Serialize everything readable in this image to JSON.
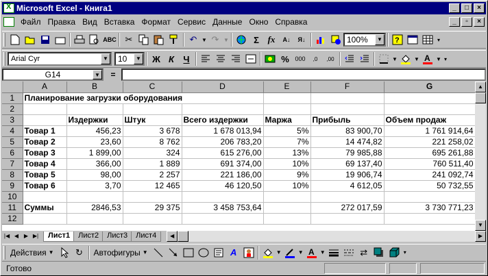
{
  "window": {
    "title": "Microsoft Excel - Книга1",
    "controls": [
      "_",
      "□",
      "×"
    ]
  },
  "menu": {
    "items": [
      "Файл",
      "Правка",
      "Вид",
      "Вставка",
      "Формат",
      "Сервис",
      "Данные",
      "Окно",
      "Справка"
    ],
    "doc_controls": [
      "_",
      "▫",
      "×"
    ]
  },
  "toolbar_standard": {
    "icons": [
      "new-icon",
      "open-icon",
      "save-icon",
      "mail-icon",
      "print-icon",
      "preview-icon",
      "spelling-icon",
      "cut-icon",
      "copy-icon",
      "paste-icon",
      "format-painter-icon",
      "undo-icon",
      "redo-icon",
      "hyperlink-icon",
      "autosum-icon",
      "function-icon",
      "sort-asc-icon",
      "sort-desc-icon",
      "chart-wizard-icon",
      "drawing-icon",
      "help-icon",
      "table-icon"
    ],
    "zoom": "100%"
  },
  "toolbar_formatting": {
    "font": "Arial Cyr",
    "size": "10",
    "bold": "Ж",
    "italic": "К",
    "underline": "Ч",
    "percent": "%",
    "thousands": "000"
  },
  "formula_bar": {
    "name_box": "G14",
    "equals": "=",
    "formula": ""
  },
  "sheet": {
    "columns": [
      "A",
      "B",
      "C",
      "D",
      "E",
      "F",
      "G"
    ],
    "title": "Планирование загрузки оборудования",
    "headers": [
      "Издержки",
      "Штук",
      "Всего издержки",
      "Маржа",
      "Прибыль",
      "Объем продаж"
    ],
    "rows": [
      {
        "name": "Товар 1",
        "values": [
          "456,23",
          "3 678",
          "1 678 013,94",
          "5%",
          "83 900,70",
          "1 761 914,64"
        ]
      },
      {
        "name": "Товар 2",
        "values": [
          "23,60",
          "8 762",
          "206 783,20",
          "7%",
          "14 474,82",
          "221 258,02"
        ]
      },
      {
        "name": "Товар 3",
        "values": [
          "1 899,00",
          "324",
          "615 276,00",
          "13%",
          "79 985,88",
          "695 261,88"
        ]
      },
      {
        "name": "Товар 4",
        "values": [
          "366,00",
          "1 889",
          "691 374,00",
          "10%",
          "69 137,40",
          "760 511,40"
        ]
      },
      {
        "name": "Товар 5",
        "values": [
          "98,00",
          "2 257",
          "221 186,00",
          "9%",
          "19 906,74",
          "241 092,74"
        ]
      },
      {
        "name": "Товар 6",
        "values": [
          "3,70",
          "12 465",
          "46 120,50",
          "10%",
          "4 612,05",
          "50 732,55"
        ]
      }
    ],
    "totals": {
      "name": "Суммы",
      "values": [
        "2846,53",
        "29 375",
        "3 458 753,64",
        "",
        "272 017,59",
        "3 730 771,23"
      ]
    }
  },
  "tabs": [
    "Лист1",
    "Лист2",
    "Лист3",
    "Лист4"
  ],
  "drawing": {
    "actions": "Действия",
    "autoshapes": "Автофигуры"
  },
  "status": "Готово"
}
